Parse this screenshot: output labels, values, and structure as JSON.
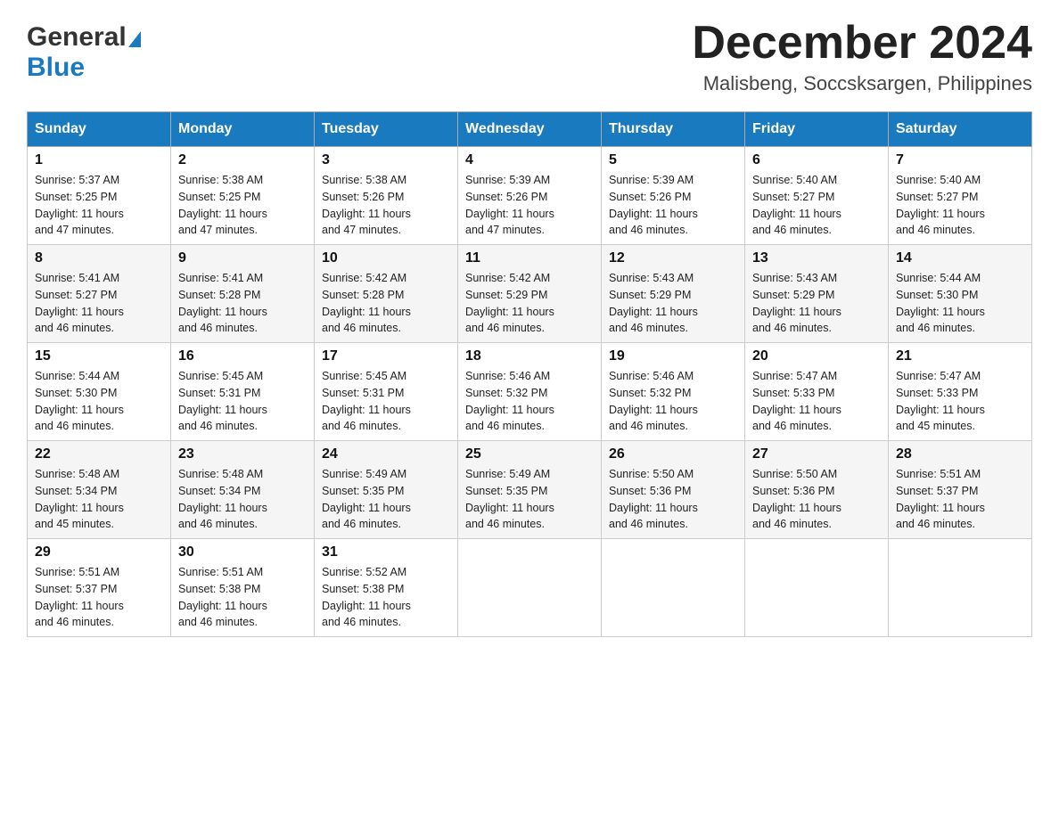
{
  "header": {
    "logo_general": "General",
    "logo_blue": "Blue",
    "month_title": "December 2024",
    "location": "Malisbeng, Soccsksargen, Philippines"
  },
  "days_of_week": [
    "Sunday",
    "Monday",
    "Tuesday",
    "Wednesday",
    "Thursday",
    "Friday",
    "Saturday"
  ],
  "weeks": [
    [
      {
        "day": "1",
        "sunrise": "5:37 AM",
        "sunset": "5:25 PM",
        "daylight": "11 hours and 47 minutes."
      },
      {
        "day": "2",
        "sunrise": "5:38 AM",
        "sunset": "5:25 PM",
        "daylight": "11 hours and 47 minutes."
      },
      {
        "day": "3",
        "sunrise": "5:38 AM",
        "sunset": "5:26 PM",
        "daylight": "11 hours and 47 minutes."
      },
      {
        "day": "4",
        "sunrise": "5:39 AM",
        "sunset": "5:26 PM",
        "daylight": "11 hours and 47 minutes."
      },
      {
        "day": "5",
        "sunrise": "5:39 AM",
        "sunset": "5:26 PM",
        "daylight": "11 hours and 46 minutes."
      },
      {
        "day": "6",
        "sunrise": "5:40 AM",
        "sunset": "5:27 PM",
        "daylight": "11 hours and 46 minutes."
      },
      {
        "day": "7",
        "sunrise": "5:40 AM",
        "sunset": "5:27 PM",
        "daylight": "11 hours and 46 minutes."
      }
    ],
    [
      {
        "day": "8",
        "sunrise": "5:41 AM",
        "sunset": "5:27 PM",
        "daylight": "11 hours and 46 minutes."
      },
      {
        "day": "9",
        "sunrise": "5:41 AM",
        "sunset": "5:28 PM",
        "daylight": "11 hours and 46 minutes."
      },
      {
        "day": "10",
        "sunrise": "5:42 AM",
        "sunset": "5:28 PM",
        "daylight": "11 hours and 46 minutes."
      },
      {
        "day": "11",
        "sunrise": "5:42 AM",
        "sunset": "5:29 PM",
        "daylight": "11 hours and 46 minutes."
      },
      {
        "day": "12",
        "sunrise": "5:43 AM",
        "sunset": "5:29 PM",
        "daylight": "11 hours and 46 minutes."
      },
      {
        "day": "13",
        "sunrise": "5:43 AM",
        "sunset": "5:29 PM",
        "daylight": "11 hours and 46 minutes."
      },
      {
        "day": "14",
        "sunrise": "5:44 AM",
        "sunset": "5:30 PM",
        "daylight": "11 hours and 46 minutes."
      }
    ],
    [
      {
        "day": "15",
        "sunrise": "5:44 AM",
        "sunset": "5:30 PM",
        "daylight": "11 hours and 46 minutes."
      },
      {
        "day": "16",
        "sunrise": "5:45 AM",
        "sunset": "5:31 PM",
        "daylight": "11 hours and 46 minutes."
      },
      {
        "day": "17",
        "sunrise": "5:45 AM",
        "sunset": "5:31 PM",
        "daylight": "11 hours and 46 minutes."
      },
      {
        "day": "18",
        "sunrise": "5:46 AM",
        "sunset": "5:32 PM",
        "daylight": "11 hours and 46 minutes."
      },
      {
        "day": "19",
        "sunrise": "5:46 AM",
        "sunset": "5:32 PM",
        "daylight": "11 hours and 46 minutes."
      },
      {
        "day": "20",
        "sunrise": "5:47 AM",
        "sunset": "5:33 PM",
        "daylight": "11 hours and 46 minutes."
      },
      {
        "day": "21",
        "sunrise": "5:47 AM",
        "sunset": "5:33 PM",
        "daylight": "11 hours and 45 minutes."
      }
    ],
    [
      {
        "day": "22",
        "sunrise": "5:48 AM",
        "sunset": "5:34 PM",
        "daylight": "11 hours and 45 minutes."
      },
      {
        "day": "23",
        "sunrise": "5:48 AM",
        "sunset": "5:34 PM",
        "daylight": "11 hours and 46 minutes."
      },
      {
        "day": "24",
        "sunrise": "5:49 AM",
        "sunset": "5:35 PM",
        "daylight": "11 hours and 46 minutes."
      },
      {
        "day": "25",
        "sunrise": "5:49 AM",
        "sunset": "5:35 PM",
        "daylight": "11 hours and 46 minutes."
      },
      {
        "day": "26",
        "sunrise": "5:50 AM",
        "sunset": "5:36 PM",
        "daylight": "11 hours and 46 minutes."
      },
      {
        "day": "27",
        "sunrise": "5:50 AM",
        "sunset": "5:36 PM",
        "daylight": "11 hours and 46 minutes."
      },
      {
        "day": "28",
        "sunrise": "5:51 AM",
        "sunset": "5:37 PM",
        "daylight": "11 hours and 46 minutes."
      }
    ],
    [
      {
        "day": "29",
        "sunrise": "5:51 AM",
        "sunset": "5:37 PM",
        "daylight": "11 hours and 46 minutes."
      },
      {
        "day": "30",
        "sunrise": "5:51 AM",
        "sunset": "5:38 PM",
        "daylight": "11 hours and 46 minutes."
      },
      {
        "day": "31",
        "sunrise": "5:52 AM",
        "sunset": "5:38 PM",
        "daylight": "11 hours and 46 minutes."
      },
      null,
      null,
      null,
      null
    ]
  ],
  "labels": {
    "sunrise": "Sunrise:",
    "sunset": "Sunset:",
    "daylight": "Daylight:"
  }
}
